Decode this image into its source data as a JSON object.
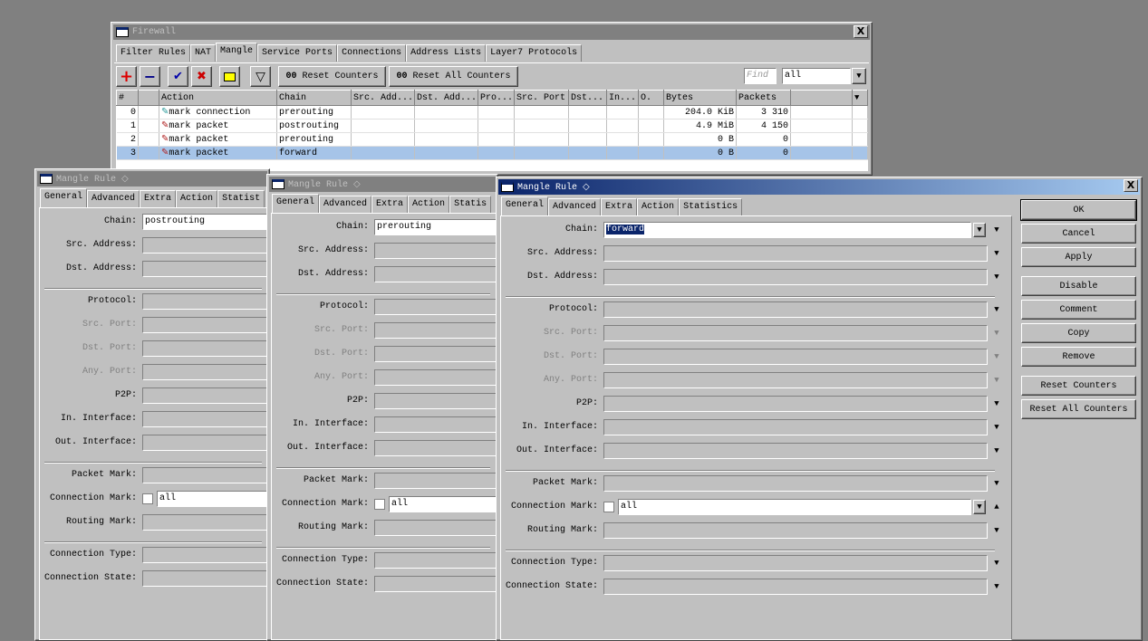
{
  "firewall": {
    "title": "Firewall",
    "tabs": [
      "Filter Rules",
      "NAT",
      "Mangle",
      "Service Ports",
      "Connections",
      "Address Lists",
      "Layer7 Protocols"
    ],
    "selected_tab": "Mangle",
    "toolbar": {
      "add": "+",
      "remove": "−",
      "enable": "✔",
      "disable": "✖",
      "comment": "▭",
      "filter": "▽",
      "reset_counters": "Reset Counters",
      "reset_all_counters": "Reset All Counters",
      "counter_prefix": "00",
      "find_placeholder": "Find",
      "filter_value": "all"
    },
    "columns": [
      "#",
      "",
      "Action",
      "Chain",
      "Src. Add...",
      "Dst. Add...",
      "Pro...",
      "Src. Port",
      "Dst...",
      "In...",
      "O.",
      "Bytes",
      "Packets",
      ""
    ],
    "rows": [
      {
        "num": "0",
        "action": "mark connection",
        "icon": "pencil-teal",
        "chain": "prerouting",
        "bytes": "204.0 KiB",
        "packets": "3 310"
      },
      {
        "num": "1",
        "action": "mark packet",
        "icon": "pencil-red",
        "chain": "postrouting",
        "bytes": "4.9 MiB",
        "packets": "4 150"
      },
      {
        "num": "2",
        "action": "mark packet",
        "icon": "pencil-red",
        "chain": "prerouting",
        "bytes": "0 B",
        "packets": "0"
      },
      {
        "num": "3",
        "action": "mark packet",
        "icon": "pencil-red",
        "chain": "forward",
        "bytes": "0 B",
        "packets": "0",
        "selected": true
      }
    ]
  },
  "dialogs": [
    {
      "title": "Mangle Rule ◇",
      "active": false,
      "tabs": [
        "General",
        "Advanced",
        "Extra",
        "Action",
        "Statist"
      ],
      "chain": "postrouting",
      "connection_mark": "all"
    },
    {
      "title": "Mangle Rule ◇",
      "active": false,
      "tabs": [
        "General",
        "Advanced",
        "Extra",
        "Action",
        "Statis"
      ],
      "chain": "prerouting",
      "connection_mark": "all"
    },
    {
      "title": "Mangle Rule ◇",
      "active": true,
      "tabs": [
        "General",
        "Advanced",
        "Extra",
        "Action",
        "Statistics"
      ],
      "chain": "forward",
      "connection_mark": "all",
      "buttons": [
        "OK",
        "Cancel",
        "Apply",
        "Disable",
        "Comment",
        "Copy",
        "Remove",
        "Reset Counters",
        "Reset All Counters"
      ]
    }
  ],
  "field_groups": [
    [
      {
        "label": "Chain:",
        "key": "chain"
      },
      {
        "label": "Src. Address:"
      },
      {
        "label": "Dst. Address:"
      }
    ],
    [
      {
        "label": "Protocol:"
      },
      {
        "label": "Src. Port:",
        "dim": true
      },
      {
        "label": "Dst. Port:",
        "dim": true
      },
      {
        "label": "Any. Port:",
        "dim": true
      },
      {
        "label": "P2P:"
      },
      {
        "label": "In. Interface:"
      },
      {
        "label": "Out. Interface:"
      }
    ],
    [
      {
        "label": "Packet Mark:"
      },
      {
        "label": "Connection Mark:",
        "key": "connection_mark",
        "checkbox": true
      },
      {
        "label": "Routing Mark:"
      }
    ],
    [
      {
        "label": "Connection Type:"
      },
      {
        "label": "Connection State:"
      }
    ]
  ],
  "colors": {
    "desktop": "#808080",
    "window": "#c0c0c0",
    "active_title": "#0a246a",
    "selected_row": "#a6c4e8"
  }
}
